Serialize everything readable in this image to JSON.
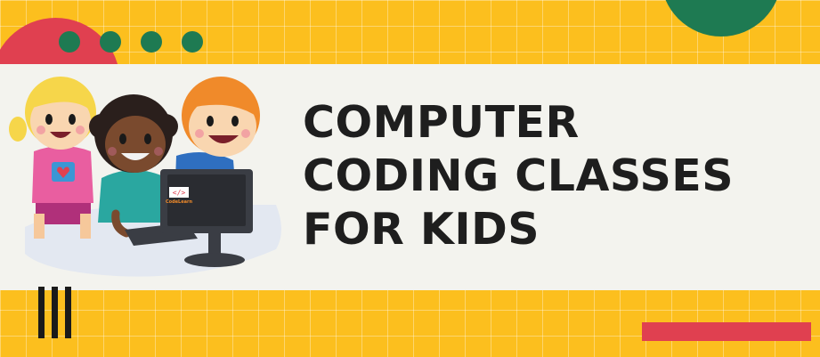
{
  "title_lines": [
    "COMPUTER",
    "CODING CLASSES",
    "FOR KIDS"
  ],
  "monitor_brand": "CodeLearn",
  "colors": {
    "background": "#fcbf1e",
    "band": "#f3f3ee",
    "accent_red": "#e04050",
    "accent_green": "#1e7a52",
    "text": "#1e1e1e"
  },
  "illustration": "three-kids-at-computer"
}
